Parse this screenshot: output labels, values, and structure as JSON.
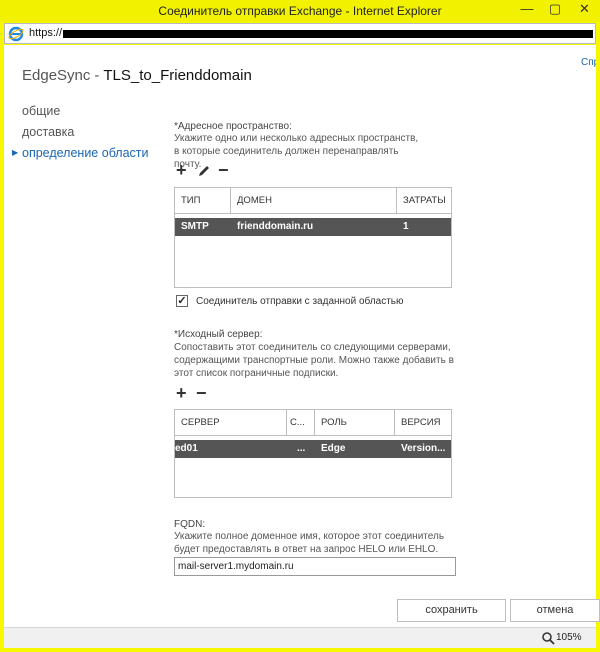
{
  "window": {
    "title": "Соединитель отправки Exchange - Internet Explorer",
    "min_label": "—",
    "max_label": "▢",
    "close_label": "✕"
  },
  "address": {
    "prefix": "https://"
  },
  "header": {
    "app": "EdgeSync",
    "separator": "-",
    "connector": "TLS_to_Frienddomain",
    "help": "Спр"
  },
  "nav": {
    "items": [
      {
        "label": "общие"
      },
      {
        "label": "доставка"
      },
      {
        "label": "определение области"
      }
    ],
    "active_index": 2
  },
  "address_space": {
    "label": "*Адресное пространство:",
    "description": "Укажите одно или несколько адресных пространств, в которые соединитель должен перенаправлять почту.",
    "columns": [
      "ТИП",
      "ДОМЕН",
      "ЗАТРАТЫ"
    ],
    "rows": [
      {
        "type": "SMTP",
        "domain": "frienddomain.ru",
        "cost": "1"
      }
    ]
  },
  "scoped": {
    "checked": true,
    "label": "Соединитель отправки с заданной областью"
  },
  "source_server": {
    "label": "*Исходный сервер:",
    "description": "Сопоставить этот соединитель со следующими серверами, содержащими транспортные роли. Можно также добавить в этот список пограничные подписки.",
    "columns": [
      "СЕРВЕР",
      "С...",
      "РОЛЬ",
      "ВЕРСИЯ"
    ],
    "rows": [
      {
        "server": "ed01",
        "site": "...",
        "role": "Edge",
        "version": "Version..."
      }
    ]
  },
  "fqdn": {
    "label": "FQDN:",
    "description": "Укажите полное доменное имя, которое этот соединитель будет предоставлять в ответ на запрос HELO или EHLO.",
    "value": "mail-server1.mydomain.ru"
  },
  "buttons": {
    "save": "сохранить",
    "cancel": "отмена"
  },
  "status": {
    "zoom": "105%"
  },
  "colors": {
    "accent": "#1a66b3",
    "frame": "#ffff00",
    "selected_row": "#555555"
  }
}
